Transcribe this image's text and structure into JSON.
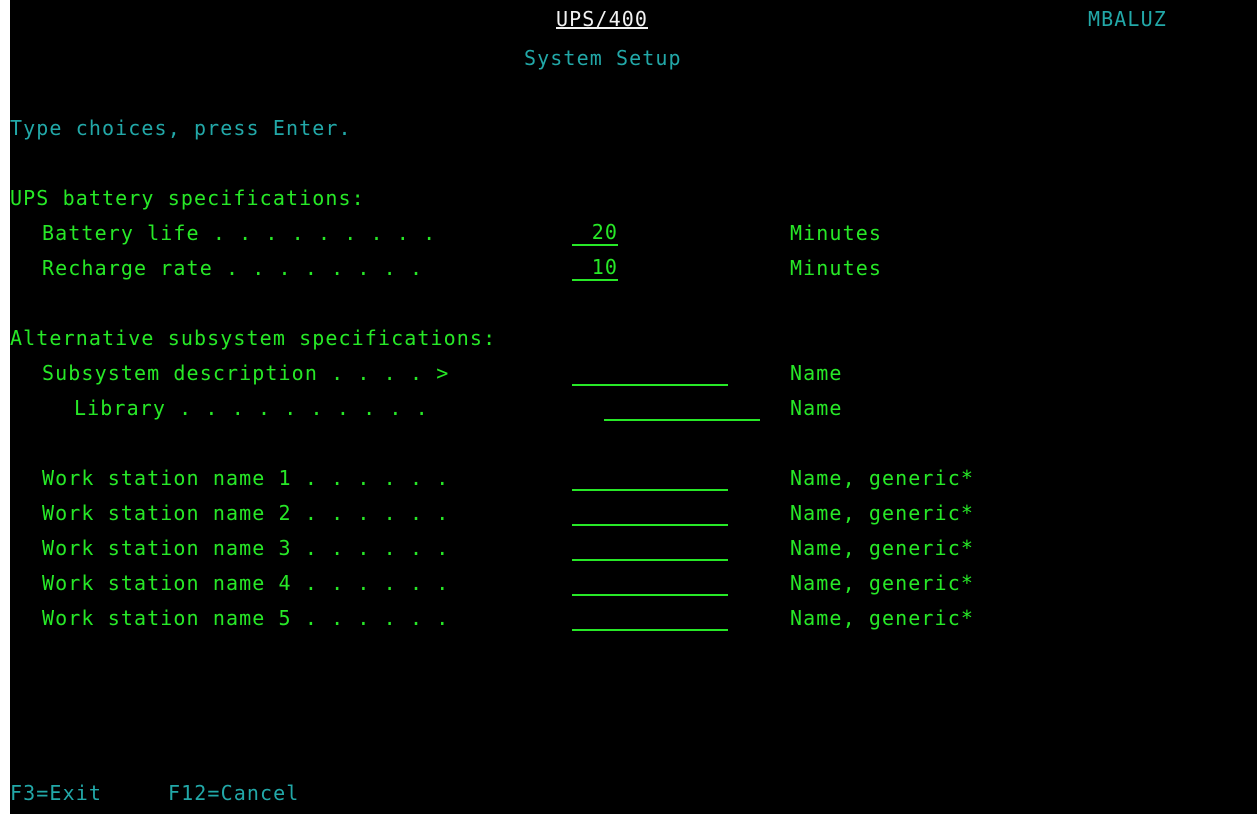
{
  "header": {
    "title": "UPS/400",
    "user": "MBALUZ",
    "subtitle": "System Setup"
  },
  "instruction": "Type choices, press Enter.",
  "battery_section": {
    "heading": "UPS battery specifications:",
    "battery_life": {
      "label": "Battery life . . . . . . . . .",
      "value": "20",
      "unit": "Minutes"
    },
    "recharge_rate": {
      "label": "Recharge rate . . . . . . . .",
      "value": "10",
      "unit": "Minutes"
    }
  },
  "subsystem_section": {
    "heading": "Alternative subsystem specifications:",
    "subsystem_description": {
      "label": "Subsystem description . . . . >",
      "value": "",
      "hint": "Name"
    },
    "library": {
      "label": "Library . . . . . . . . . .",
      "value": "",
      "hint": "Name"
    }
  },
  "workstations": [
    {
      "label": "Work station name 1 . . . . . .",
      "value": "",
      "hint": "Name, generic*"
    },
    {
      "label": "Work station name 2 . . . . . .",
      "value": "",
      "hint": "Name, generic*"
    },
    {
      "label": "Work station name 3 . . . . . .",
      "value": "",
      "hint": "Name, generic*"
    },
    {
      "label": "Work station name 4 . . . . . .",
      "value": "",
      "hint": "Name, generic*"
    },
    {
      "label": "Work station name 5 . . . . . .",
      "value": "",
      "hint": "Name, generic*"
    }
  ],
  "function_keys": {
    "exit": "F3=Exit",
    "cancel": "F12=Cancel"
  },
  "colors": {
    "background": "#000000",
    "field_green": "#27e827",
    "info_cyan": "#22a8a8",
    "title_white": "#f2f2f2"
  }
}
